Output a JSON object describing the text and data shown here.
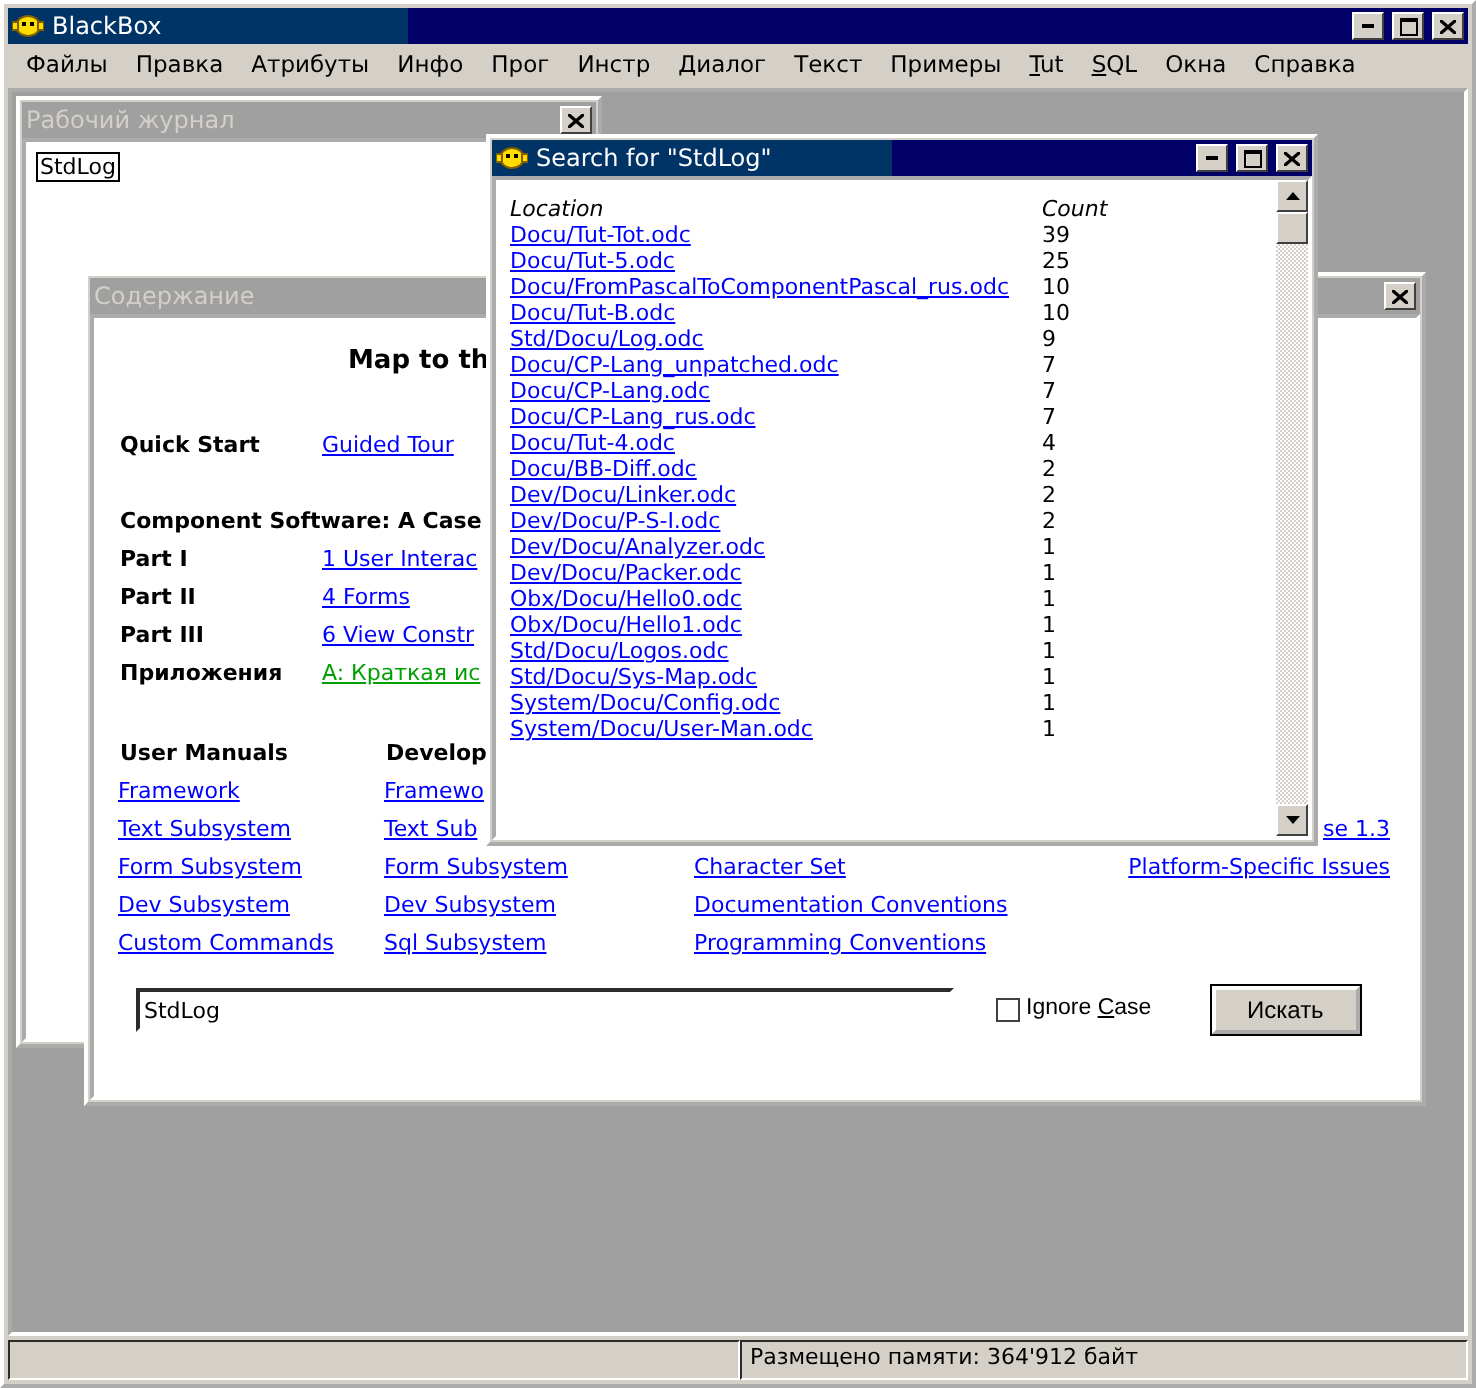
{
  "app": {
    "title": "BlackBox"
  },
  "menu": [
    {
      "label": "Файлы"
    },
    {
      "label": "Правка"
    },
    {
      "label": "Атрибуты"
    },
    {
      "label": "Инфо"
    },
    {
      "label": "Прог"
    },
    {
      "label": "Инстр"
    },
    {
      "label": "Диалог"
    },
    {
      "label": "Текст"
    },
    {
      "label": "Примеры"
    },
    {
      "mnemonic": "T",
      "rest": "ut"
    },
    {
      "mnemonic": "S",
      "rest": "QL"
    },
    {
      "label": "Окна"
    },
    {
      "label": "Справка"
    }
  ],
  "log_window": {
    "title": "Рабочий журнал",
    "entry": "StdLog"
  },
  "contents_window": {
    "title": "Содержание",
    "heading": "Map to th",
    "quick_start": {
      "label": "Quick Start",
      "link": "Guided Tour"
    },
    "case_heading": "Component Software: A Case",
    "parts": [
      {
        "label": "Part I",
        "link": "1 User Interac",
        "color": "#0000ff"
      },
      {
        "label": "Part II",
        "link": "4 Forms",
        "color": "#0000ff"
      },
      {
        "label": "Part III",
        "link": "6 View Constr",
        "color": "#0000ff"
      },
      {
        "label": "Приложения",
        "link": "A: Краткая ис",
        "color": "#00a000"
      }
    ],
    "headings": {
      "column_1": "User Manuals",
      "column_2": "Develop"
    },
    "link_rows": [
      {
        "column_1": "Framework",
        "column_2": "Framewo"
      },
      {
        "column_1": "Text Subsystem",
        "column_2": "Text Sub",
        "column_4": "se 1.3"
      },
      {
        "column_1": "Form Subsystem",
        "column_2": "Form Subsystem",
        "column_3": "Character Set",
        "column_4": "Platform-Specific Issues"
      },
      {
        "column_1": "Dev Subsystem",
        "column_2": "Dev Subsystem",
        "column_3": "Documentation Conventions"
      },
      {
        "column_1": "Custom Commands",
        "column_2": "Sql Subsystem",
        "column_3": "Programming Conventions"
      }
    ],
    "search_field": {
      "value": "StdLog"
    },
    "ignore_case": {
      "before": "Ignore ",
      "mnemonic": "C",
      "rest": "ase",
      "checked": false
    },
    "search_button": "Искать"
  },
  "search_window": {
    "title": "Search for \"StdLog\"",
    "columns": [
      "Location",
      "Count"
    ],
    "rows": [
      {
        "location": "Docu/Tut-Tot.odc",
        "count": "39"
      },
      {
        "location": "Docu/Tut-5.odc",
        "count": "25"
      },
      {
        "location": "Docu/FromPascalToComponentPascal_rus.odc",
        "count": "10"
      },
      {
        "location": "Docu/Tut-B.odc",
        "count": "10"
      },
      {
        "location": "Std/Docu/Log.odc",
        "count": "9"
      },
      {
        "location": "Docu/CP-Lang_unpatched.odc",
        "count": "7"
      },
      {
        "location": "Docu/CP-Lang.odc",
        "count": "7"
      },
      {
        "location": "Docu/CP-Lang_rus.odc",
        "count": "7"
      },
      {
        "location": "Docu/Tut-4.odc",
        "count": "4"
      },
      {
        "location": "Docu/BB-Diff.odc",
        "count": "2"
      },
      {
        "location": "Dev/Docu/Linker.odc",
        "count": "2"
      },
      {
        "location": "Dev/Docu/P-S-I.odc",
        "count": "2"
      },
      {
        "location": "Dev/Docu/Analyzer.odc",
        "count": "1"
      },
      {
        "location": "Dev/Docu/Packer.odc",
        "count": "1"
      },
      {
        "location": "Obx/Docu/Hello0.odc",
        "count": "1"
      },
      {
        "location": "Obx/Docu/Hello1.odc",
        "count": "1"
      },
      {
        "location": "Std/Docu/Logos.odc",
        "count": "1"
      },
      {
        "location": "Std/Docu/Sys-Map.odc",
        "count": "1"
      },
      {
        "location": "System/Docu/Config.odc",
        "count": "1"
      },
      {
        "location": "System/Docu/User-Man.odc",
        "count": "1"
      }
    ]
  },
  "status_bar": {
    "memory": "Размещено памяти: 364'912 байт"
  }
}
